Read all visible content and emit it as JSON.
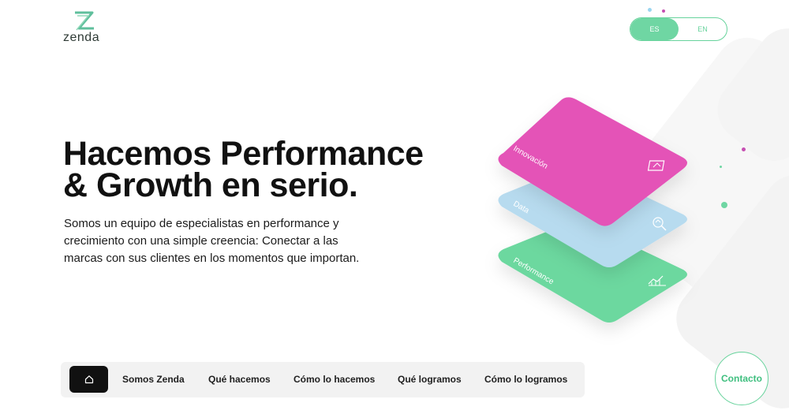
{
  "brand": {
    "logo_text": "zenda",
    "logo_icon": "zenda-z-icon",
    "accent": "#6fd6a3",
    "pink": "#e452b7",
    "blue": "#b7dbef",
    "green": "#6cd89f"
  },
  "lang": {
    "options": [
      "ES",
      "EN"
    ],
    "active": "ES"
  },
  "hero": {
    "title_line1": "Hacemos Performance",
    "title_line2": "& Growth en serio.",
    "description": "Somos un equipo de especialistas en performance y crecimiento con una simple creencia: Conectar a las marcas con sus clientes en los momentos que importan."
  },
  "cards": [
    {
      "label": "Innovación",
      "icon": "innovation-icon",
      "color": "#e452b7"
    },
    {
      "label": "Data",
      "icon": "data-icon",
      "color": "#b7dbef"
    },
    {
      "label": "Performance",
      "icon": "growth-chart-icon",
      "color": "#6cd89f"
    }
  ],
  "nav": {
    "home_icon": "home-icon",
    "items": [
      "Somos Zenda",
      "Qué hacemos",
      "Cómo lo hacemos",
      "Qué logramos",
      "Cómo lo logramos"
    ]
  },
  "contact": {
    "label": "Contacto"
  }
}
